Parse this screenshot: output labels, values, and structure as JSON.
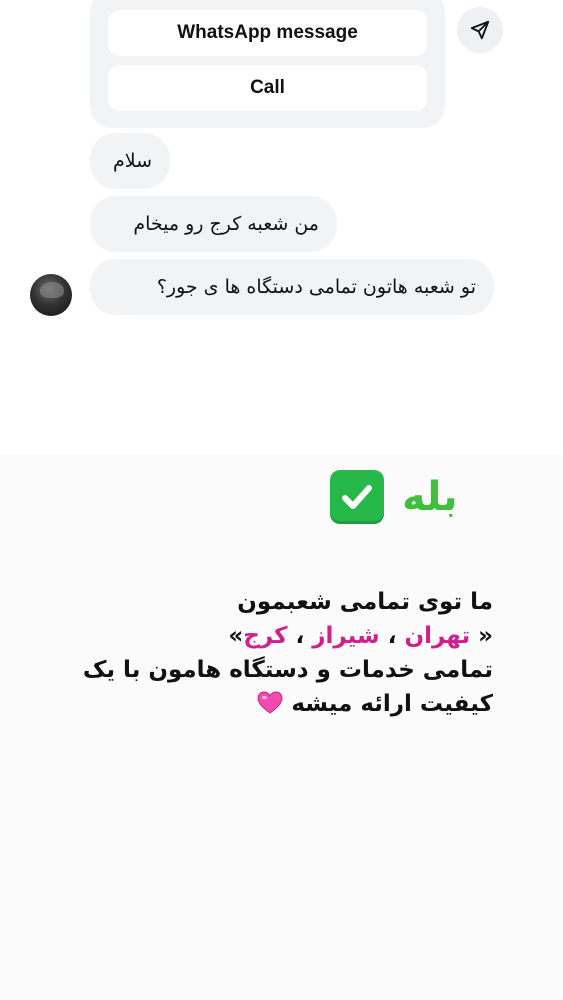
{
  "cta": {
    "whatsapp_label": "WhatsApp message",
    "call_label": "Call"
  },
  "messages": [
    {
      "text": "سلام"
    },
    {
      "text": "من شعبه کرج رو میخام"
    },
    {
      "text": "تو شعبه هاتون تمامی دستگاه ها ی جور؟"
    }
  ],
  "reply": {
    "yes": "بله",
    "line1": "ما توی تمامی شعبمون",
    "quote_open": "«",
    "city1": "تهران",
    "sep1": "،",
    "city2": "شیراز",
    "sep2": "،",
    "city3": "کرج",
    "quote_close": "»",
    "line3": "تمامی خدمات و دستگاه هامون با یک",
    "line4": "کیفیت ارائه میشه"
  },
  "colors": {
    "accent_green": "#3fbf3b",
    "city_pink": "#d1208a"
  },
  "icons": [
    "send-icon",
    "check-mark-icon",
    "pink-heart-icon"
  ]
}
